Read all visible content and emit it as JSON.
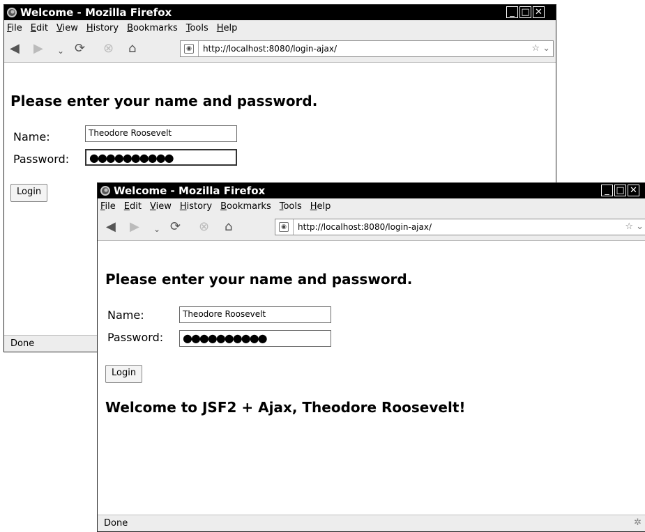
{
  "back_window": {
    "title": "Welcome - Mozilla Firefox",
    "menu": [
      "File",
      "Edit",
      "View",
      "History",
      "Bookmarks",
      "Tools",
      "Help"
    ],
    "url": "http://localhost:8080/login-ajax/",
    "prompt": "Please enter your name and password.",
    "name_label": "Name:",
    "name_value": "Theodore Roosevelt",
    "password_label": "Password:",
    "password_value": "●●●●●●●●●●",
    "login_label": "Login",
    "status": "Done"
  },
  "front_window": {
    "title": "Welcome - Mozilla Firefox",
    "menu": [
      "File",
      "Edit",
      "View",
      "History",
      "Bookmarks",
      "Tools",
      "Help"
    ],
    "url": "http://localhost:8080/login-ajax/",
    "prompt": "Please enter your name and password.",
    "name_label": "Name:",
    "name_value": "Theodore Roosevelt",
    "password_label": "Password:",
    "password_value": "●●●●●●●●●●",
    "login_label": "Login",
    "welcome": "Welcome to JSF2 + Ajax, Theodore Roosevelt!",
    "status": "Done"
  },
  "icons": {
    "back": "back-arrow-icon",
    "forward": "forward-arrow-icon",
    "dropdown": "chevron-down-icon",
    "reload": "reload-icon",
    "stop": "stop-icon",
    "home": "home-icon",
    "site": "site-identity-icon",
    "bookmark": "star-icon"
  }
}
